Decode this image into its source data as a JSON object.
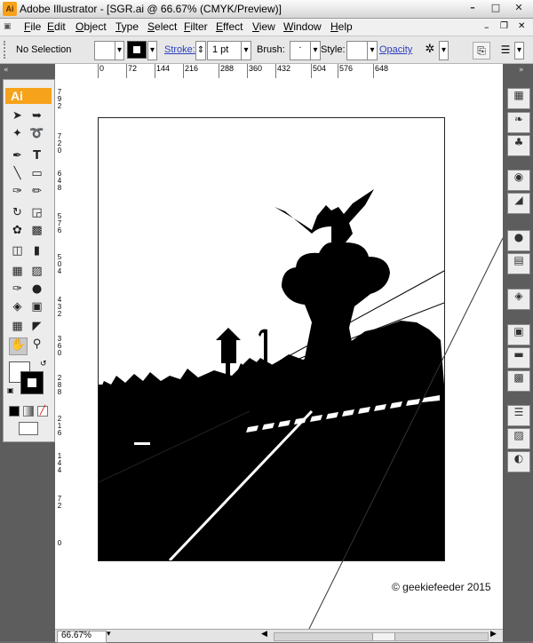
{
  "titlebar": {
    "app_icon": "Ai",
    "title": "Adobe Illustrator - [SGR.ai @ 66.67% (CMYK/Preview)]",
    "controls": [
      "minimize-icon",
      "maximize-icon",
      "close-icon"
    ]
  },
  "menubar": {
    "items": [
      "File",
      "Edit",
      "Object",
      "Type",
      "Select",
      "Filter",
      "Effect",
      "View",
      "Window",
      "Help"
    ]
  },
  "controlbar": {
    "selection_label": "No Selection",
    "stroke_label": "Stroke:",
    "stroke_value": "1 pt",
    "brush_label": "Brush:",
    "style_label": "Style:",
    "opacity_label": "Opacity"
  },
  "tools": {
    "logo": "Ai"
  },
  "rulers": {
    "horizontal": [
      "0",
      "72",
      "144",
      "216",
      "288",
      "360",
      "432",
      "504",
      "576",
      "648"
    ],
    "vertical": [
      "7 9 2",
      "7 2 0",
      "6 4 8",
      "5 7 6",
      "5 0 4",
      "4 3 2",
      "3 6 0",
      "2 8 8",
      "2 1 6",
      "1 4 4",
      "7 2",
      "0"
    ]
  },
  "canvas": {
    "copyright": "© geekiefeeder 2015"
  },
  "statusbar": {
    "zoom": "66.67%"
  },
  "colors": {
    "artwork": "#000000",
    "accent": "#f7a21b",
    "panel_dark": "#5d5d5d"
  }
}
